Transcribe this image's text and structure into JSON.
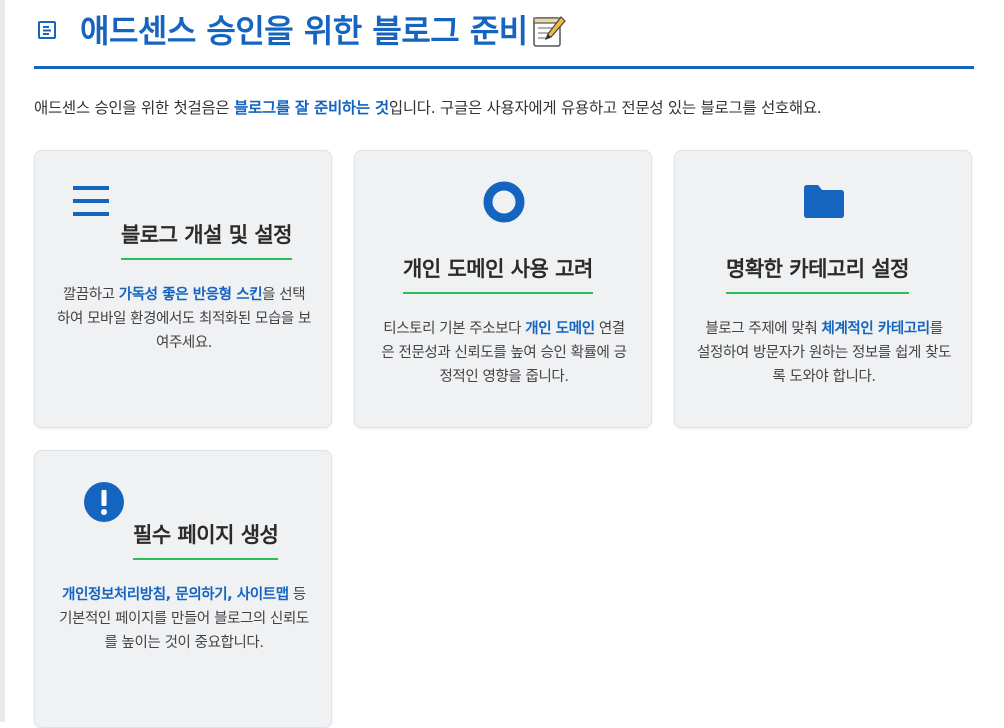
{
  "header": {
    "title": "애드센스 승인을 위한 블로그 준비"
  },
  "intro": {
    "before": "애드센스 승인을 위한 첫걸음은 ",
    "highlight": "블로그를 잘 준비하는 것",
    "after": "입니다. 구글은 사용자에게 유용하고 전문성 있는 블로그를 선호해요."
  },
  "cards": [
    {
      "icon": "menu-icon",
      "title": "블로그 개설 및 설정",
      "desc_before": "깔끔하고 ",
      "desc_highlight": "가독성 좋은 반응형 스킨",
      "desc_after": "을 선택하여 모바일 환경에서도 최적화된 모습을 보여주세요."
    },
    {
      "icon": "circle-icon",
      "title": "개인 도메인 사용 고려",
      "desc_before": "티스토리 기본 주소보다 ",
      "desc_highlight": "개인 도메인",
      "desc_after": " 연결은 전문성과 신뢰도를 높여 승인 확률에 긍정적인 영향을 줍니다."
    },
    {
      "icon": "folder-icon",
      "title": "명확한 카테고리 설정",
      "desc_before": "블로그 주제에 맞춰 ",
      "desc_highlight": "체계적인 카테고리",
      "desc_after": "를 설정하여 방문자가 원하는 정보를 쉽게 찾도록 도와야 합니다."
    },
    {
      "icon": "exclamation-icon",
      "title": "필수 페이지 생성",
      "desc_before": "",
      "desc_highlight": "개인정보처리방침, 문의하기, 사이트맵",
      "desc_after": " 등 기본적인 페이지를 만들어 블로그의 신뢰도를 높이는 것이 중요합니다."
    }
  ],
  "colors": {
    "accent": "#1565c0",
    "underline": "#2ebc5a",
    "card_bg": "#eff1f3"
  }
}
